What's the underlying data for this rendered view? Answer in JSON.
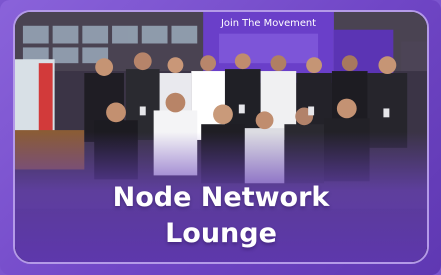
{
  "card": {
    "title_line1": "Node Network",
    "title_line2": "Lounge"
  },
  "photo": {
    "banner_text": "Join The Movement",
    "subject": "group-photo"
  },
  "colors": {
    "background": "#7c55cf",
    "border": "#b49ae8",
    "caption_text": "#ffffff",
    "banner": "#6a3fc9"
  }
}
